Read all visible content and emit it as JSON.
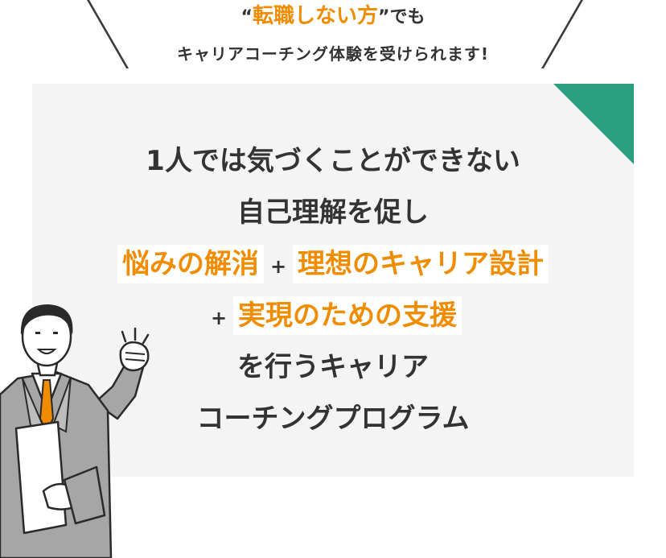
{
  "header": {
    "line1_quote_open": "“",
    "line1_highlight": "転職しない方",
    "line1_quote_close": "”",
    "line1_suffix": "でも",
    "line2": "キャリアコーチング体験を受けられます!"
  },
  "panel": {
    "line1": "1人では気づくことができない",
    "line2": "自己理解を促し",
    "tag1": "悩みの解消",
    "plus1": "+",
    "tag2": "理想のキャリア設計",
    "plus2": "+",
    "tag3": "実現のための支援",
    "line5": "を行うキャリア",
    "line6": "コーチングプログラム"
  },
  "colors": {
    "accent_orange": "#f08c00",
    "corner_green": "#2aa080",
    "panel_bg": "#f4f4f4",
    "text_dark": "#333333"
  },
  "icons": {
    "illustration": "businessman-fist-pump-illustration"
  }
}
